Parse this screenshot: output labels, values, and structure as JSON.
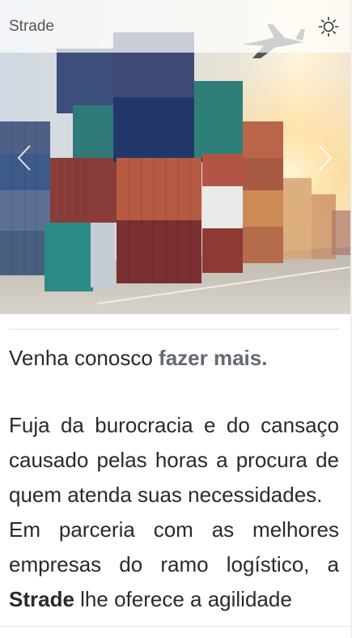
{
  "header": {
    "brand": "Strade",
    "theme_icon": "sun-icon"
  },
  "carousel": {
    "prev_icon": "chevron-left-icon",
    "next_icon": "chevron-right-icon",
    "image_subject": "shipping containers and airplane"
  },
  "content": {
    "headline_prefix": "Venha conosco ",
    "headline_bold": "fazer mais.",
    "paragraph1": "Fuja da burocracia e do cansaço causado pelas horas a procura de quem atenda suas necessidades.",
    "paragraph2_start": "Em parceria com as melhores empresas do ramo logístico, a ",
    "paragraph2_bold": "Strade",
    "paragraph2_end": " lhe oferece a agilidade"
  },
  "colors": {
    "accent": "#636a72",
    "text": "#2a2a2a"
  }
}
